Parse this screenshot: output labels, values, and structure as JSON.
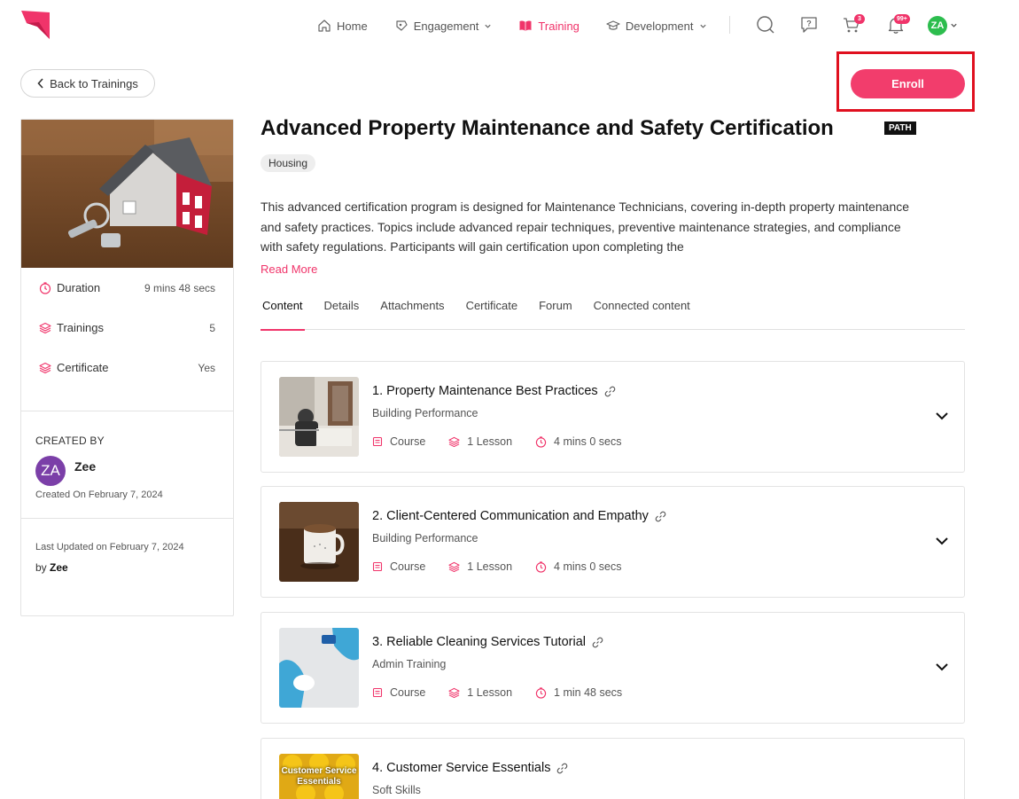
{
  "nav": {
    "items": [
      {
        "label": "Home",
        "icon": "home-icon",
        "dropdown": false,
        "active": false
      },
      {
        "label": "Engagement",
        "icon": "engagement-icon",
        "dropdown": true,
        "active": false
      },
      {
        "label": "Training",
        "icon": "book-icon",
        "dropdown": false,
        "active": true
      },
      {
        "label": "Development",
        "icon": "graduation-cap-icon",
        "dropdown": true,
        "active": false
      }
    ],
    "cart_count": "3",
    "notifications_count": "99+",
    "avatar_initials": "ZA"
  },
  "back_label": "Back to Trainings",
  "enroll_label": "Enroll",
  "training": {
    "title": "Advanced Property Maintenance and Safety Certification",
    "type_badge": "PATH",
    "tag": "Housing",
    "description": "This advanced certification program is designed for Maintenance Technicians, covering in-depth property maintenance and safety practices. Topics include advanced repair techniques, preventive maintenance strategies, and compliance with safety regulations. Participants will gain certification upon completing the",
    "read_more": "Read More"
  },
  "sidebar": {
    "meta": [
      {
        "label": "Duration",
        "value": "9 mins 48 secs",
        "icon": "clock-icon"
      },
      {
        "label": "Trainings",
        "value": "5",
        "icon": "layers-icon"
      },
      {
        "label": "Certificate",
        "value": "Yes",
        "icon": "layers-icon"
      }
    ],
    "created_by_heading": "CREATED BY",
    "author_initials": "ZA",
    "author_name": "Zee",
    "created_on": "Created On February 7, 2024",
    "last_updated": "Last Updated on February 7, 2024",
    "by_prefix": "by",
    "by_name": "Zee"
  },
  "tabs": [
    "Content",
    "Details",
    "Attachments",
    "Certificate",
    "Forum",
    "Connected content"
  ],
  "items": [
    {
      "title": "1. Property Maintenance Best Practices",
      "category": "Building Performance",
      "type": "Course",
      "lessons": "1 Lesson",
      "duration": "4 mins 0 secs"
    },
    {
      "title": "2. Client-Centered Communication and Empathy",
      "category": "Building Performance",
      "type": "Course",
      "lessons": "1 Lesson",
      "duration": "4 mins 0 secs"
    },
    {
      "title": "3. Reliable Cleaning Services Tutorial",
      "category": "Admin Training",
      "type": "Course",
      "lessons": "1 Lesson",
      "duration": "1 min 48 secs"
    },
    {
      "title": "4. Customer Service Essentials",
      "category": "Soft Skills",
      "type": "",
      "lessons": "",
      "duration": "",
      "thumb_text": "Customer Service Essentials"
    }
  ],
  "colors": {
    "accent": "#f0346a",
    "highlight_frame": "#e0101f"
  }
}
